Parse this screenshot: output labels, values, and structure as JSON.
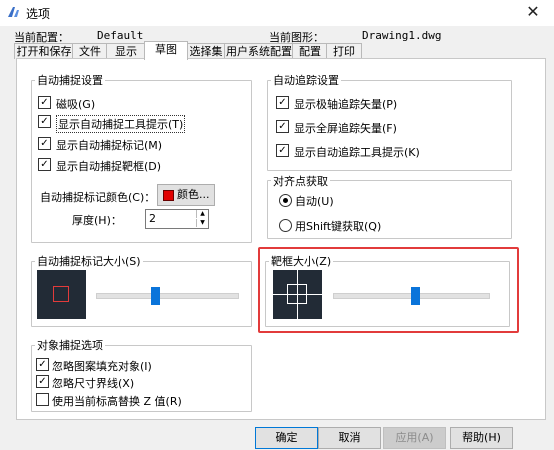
{
  "window": {
    "title": "选项",
    "close_glyph": "✕"
  },
  "profile": {
    "config_label": "当前配置：",
    "config_value": "Default",
    "drawing_label": "当前图形：",
    "drawing_value": "Drawing1.dwg"
  },
  "tabs": [
    {
      "label": "打开和保存"
    },
    {
      "label": "文件"
    },
    {
      "label": "显示"
    },
    {
      "label": "草图"
    },
    {
      "label": "选择集"
    },
    {
      "label": "用户系统配置"
    },
    {
      "label": "配置"
    },
    {
      "label": "打印"
    }
  ],
  "active_tab": "草图",
  "autosnap": {
    "title": "自动捕捉设置",
    "options": [
      {
        "label": "磁吸(G)",
        "checked": true
      },
      {
        "label": "显示自动捕捉工具提示(T)",
        "checked": true
      },
      {
        "label": "显示自动捕捉标记(M)",
        "checked": true
      },
      {
        "label": "显示自动捕捉靶框(D)",
        "checked": true
      }
    ],
    "marker_color_label": "自动捕捉标记颜色(C)：",
    "color_button_label": "颜色...",
    "marker_color": "#e00000",
    "thickness_label": "厚度(H)：",
    "thickness_value": "2"
  },
  "autotrack": {
    "title": "自动追踪设置",
    "options": [
      {
        "label": "显示极轴追踪矢量(P)",
        "checked": true
      },
      {
        "label": "显示全屏追踪矢量(F)",
        "checked": true
      },
      {
        "label": "显示自动追踪工具提示(K)",
        "checked": true
      }
    ]
  },
  "alignment": {
    "title": "对齐点获取",
    "options": [
      {
        "label": "自动(U)",
        "selected": true
      },
      {
        "label": "用Shift键获取(Q)",
        "selected": false
      }
    ]
  },
  "marker_size": {
    "title": "自动捕捉标记大小(S)",
    "slider_position": 0.43
  },
  "aperture_size": {
    "title": "靶框大小(Z)",
    "slider_position": 0.52,
    "highlight_color": "#e23b3b"
  },
  "object_snap": {
    "title": "对象捕捉选项",
    "options": [
      {
        "label": "忽略图案填充对象(I)",
        "checked": true
      },
      {
        "label": "忽略尺寸界线(X)",
        "checked": true
      },
      {
        "label": "使用当前标高替换 Z 值(R)",
        "checked": false
      }
    ]
  },
  "buttons": {
    "ok": "确定",
    "cancel": "取消",
    "apply": "应用(A)",
    "help": "帮助(H)"
  }
}
